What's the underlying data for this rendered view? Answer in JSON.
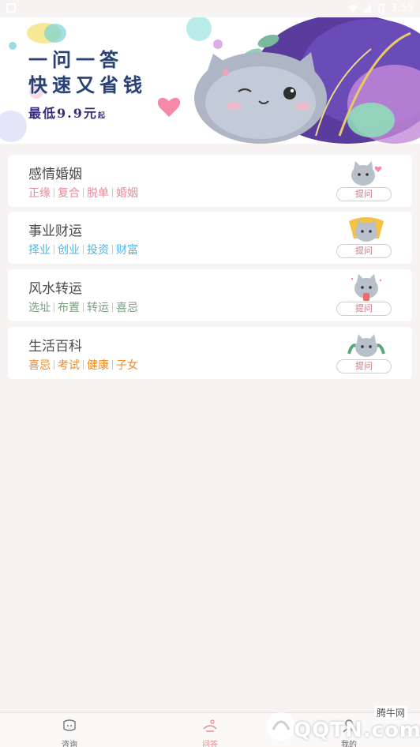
{
  "status_bar": {
    "time": "3:55"
  },
  "banner": {
    "line1": "一问一答",
    "line2": "快速又省钱",
    "line3_prefix": "最低",
    "line3_price": "9.9元",
    "line3_suffix": "起"
  },
  "categories": [
    {
      "title": "感情婚姻",
      "tags": [
        "正缘",
        "复合",
        "脱单",
        "婚姻"
      ],
      "tag_color": "#e98a9a",
      "ask_label": "提问"
    },
    {
      "title": "事业财运",
      "tags": [
        "择业",
        "创业",
        "投资",
        "财富"
      ],
      "tag_color": "#52b4e6",
      "ask_label": "提问"
    },
    {
      "title": "风水转运",
      "tags": [
        "选址",
        "布置",
        "转运",
        "喜忌"
      ],
      "tag_color": "#7c9e82",
      "ask_label": "提问"
    },
    {
      "title": "生活百科",
      "tags": [
        "喜忌",
        "考试",
        "健康",
        "子女"
      ],
      "tag_color": "#f08a2a",
      "ask_label": "提问"
    }
  ],
  "bottom_nav": {
    "items": [
      {
        "label": "咨询",
        "icon": "chat-icon",
        "active": false
      },
      {
        "label": "问答",
        "icon": "qa-icon",
        "active": true
      },
      {
        "label": "我的",
        "icon": "user-icon",
        "active": false
      }
    ]
  },
  "watermark": {
    "text_cn": "腾牛网",
    "text_en": "QQTN.com"
  }
}
